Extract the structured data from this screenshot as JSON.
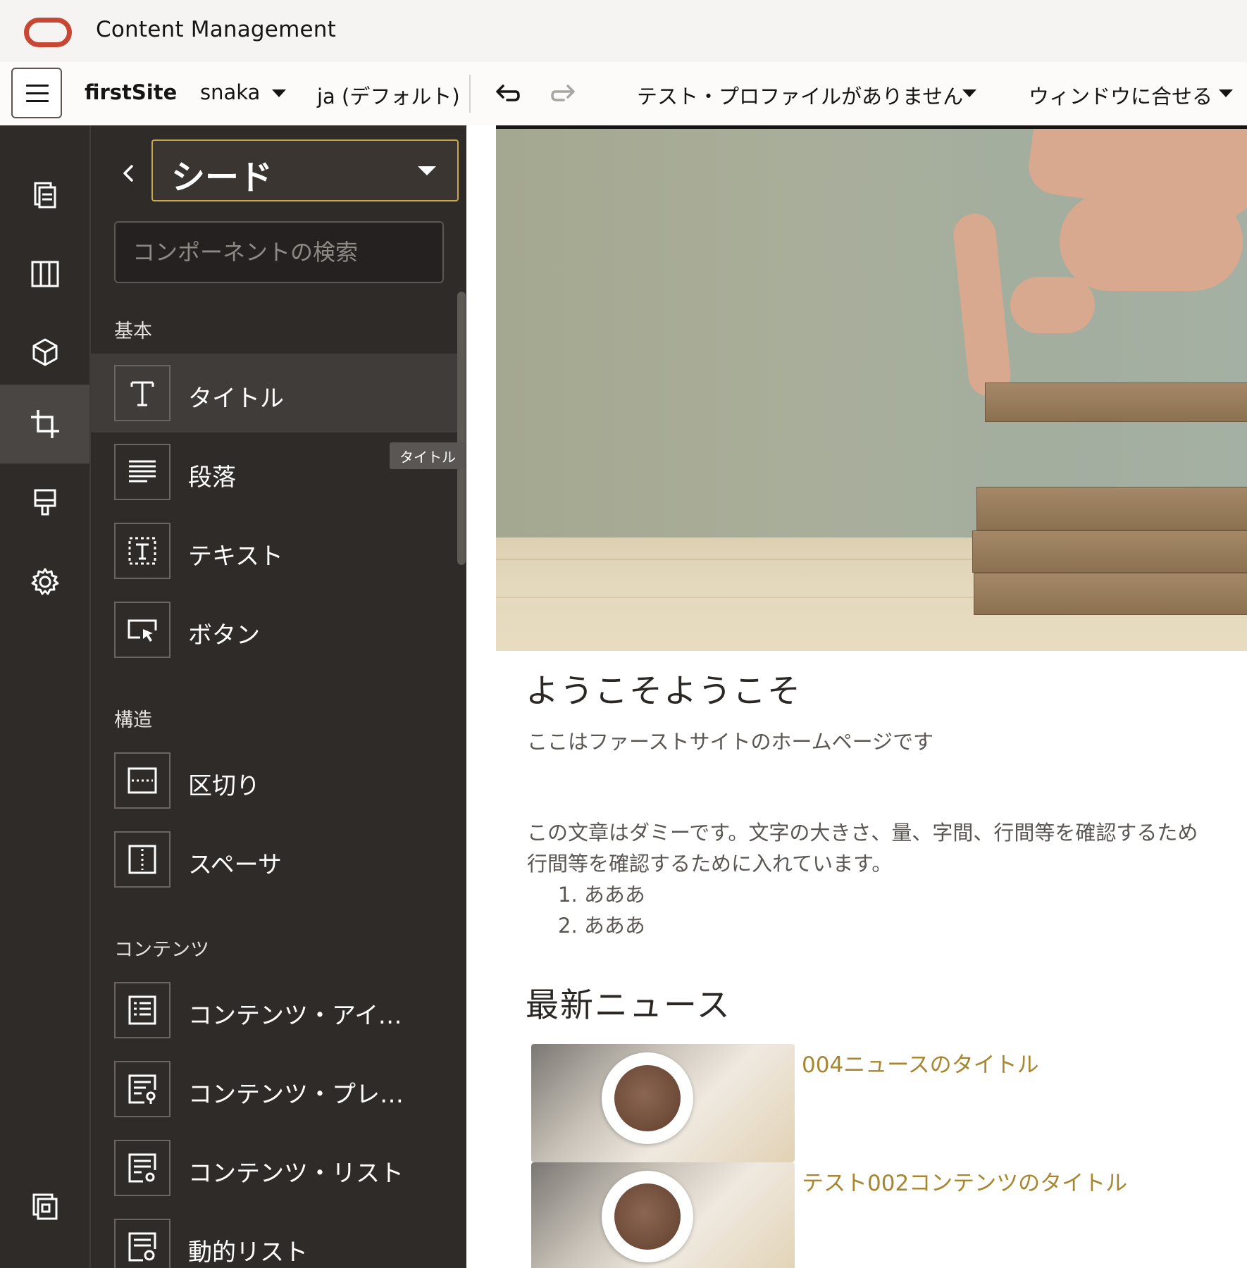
{
  "app": {
    "title": "Content Management"
  },
  "toolbar": {
    "site_name": "firstSite",
    "user": "snaka",
    "language": "ja (デフォルト)",
    "test_profile": "テスト・プロファイルがありません",
    "fit_window": "ウィンドウに合せる"
  },
  "nav_rail": {
    "items": [
      "pages-icon",
      "layout-columns-icon",
      "components-cube-icon",
      "crop-icon",
      "theme-brush-icon",
      "settings-gear-icon",
      "sections-icon"
    ],
    "active": "crop-icon"
  },
  "drawer": {
    "selected_theme": "シード",
    "search_placeholder": "コンポーネントの検索",
    "sections": {
      "basic": "基本",
      "structure": "構造",
      "content": "コンテンツ"
    },
    "basic_items": [
      {
        "label": "タイトル",
        "icon": "title-T-icon"
      },
      {
        "label": "段落",
        "icon": "paragraph-icon"
      },
      {
        "label": "テキスト",
        "icon": "text-icon"
      },
      {
        "label": "ボタン",
        "icon": "button-icon"
      }
    ],
    "structure_items": [
      {
        "label": "区切り",
        "icon": "divider-icon"
      },
      {
        "label": "スペーサ",
        "icon": "spacer-icon"
      }
    ],
    "content_items": [
      {
        "label": "コンテンツ・アイテム",
        "icon": "content-item-icon"
      },
      {
        "label": "コンテンツ・プレー…",
        "icon": "content-placeholder-icon"
      },
      {
        "label": "コンテンツ・リスト",
        "icon": "content-list-icon"
      },
      {
        "label": "動的リスト",
        "icon": "dynamic-list-icon"
      }
    ],
    "tooltip": "タイトル"
  },
  "page": {
    "heading": "ようこそようこそ",
    "subheading": "ここはファーストサイトのホームページです",
    "paragraph_line1": "この文章はダミーです。文字の大きさ、量、字間、行間等を確認するため",
    "paragraph_line2": "行間等を確認するために入れています。",
    "list": [
      "1. あああ",
      "2. あああ"
    ],
    "news_heading": "最新ニュース",
    "news": [
      {
        "title": "004ニュースのタイトル"
      },
      {
        "title": "テスト002コンテンツのタイトル"
      }
    ]
  },
  "colors": {
    "oracle_red": "#c74634",
    "accent_gold": "#c9a84d",
    "link_gold": "#a8862f",
    "drawer_bg": "#2f2b28"
  }
}
